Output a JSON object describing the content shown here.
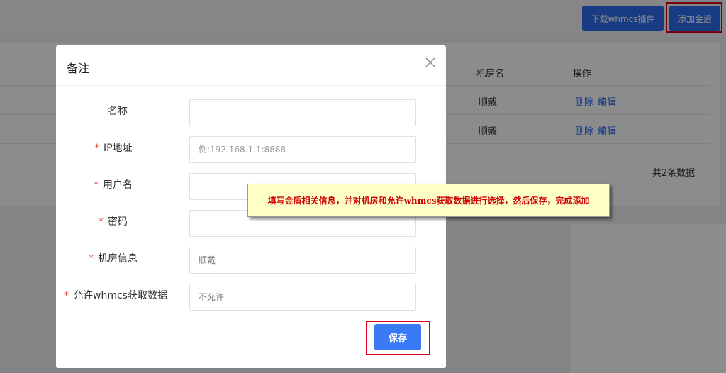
{
  "header": {
    "download_button": "下载whmcs插件",
    "add_button": "添加金盾"
  },
  "table": {
    "columns": [
      "机房名",
      "操作"
    ],
    "rows": [
      {
        "room": "顺戴",
        "delete": "删除",
        "edit": "编辑"
      },
      {
        "room": "顺戴",
        "delete": "删除",
        "edit": "编辑"
      }
    ],
    "total": "共2条数据"
  },
  "modal": {
    "title": "备注",
    "fields": {
      "name_label": "名称",
      "ip_label": "IP地址",
      "ip_placeholder": "例:192.168.1.1:8888",
      "username_label": "用户名",
      "password_label": "密码",
      "room_label": "机房信息",
      "room_value": "顺戴",
      "allow_label": "允许whmcs获取数据",
      "allow_value": "不允许"
    },
    "required_mark": "*",
    "save_button": "保存"
  },
  "tooltip": {
    "text": "填写金盾相关信息，并对机房和允许whmcs获取数据进行选择，然后保存，完成添加"
  },
  "colors": {
    "primary": "#2d6cf0",
    "highlight": "#d9001b",
    "tooltip_bg": "#ffffc8",
    "tooltip_text": "#cc0000",
    "required": "#e54d42"
  }
}
